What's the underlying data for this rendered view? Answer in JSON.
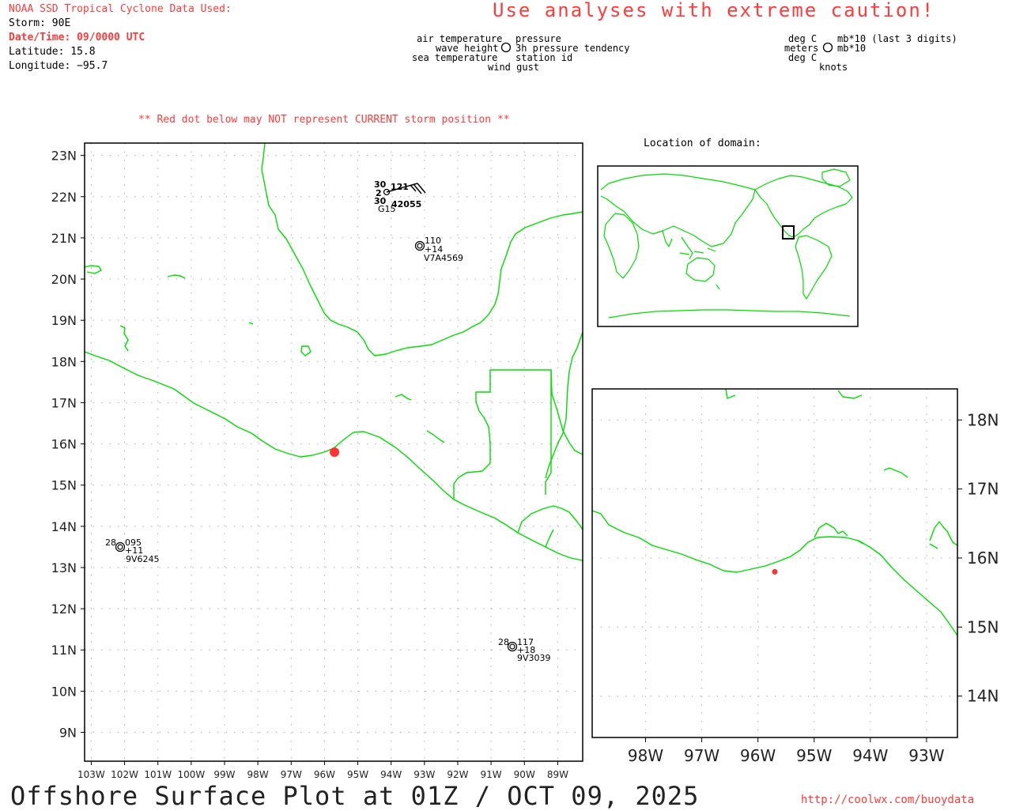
{
  "header": {
    "source": "NOAA SSD Tropical Cyclone Data Used:",
    "storm": "Storm: 90E",
    "datetime": "Date/Time: 09/0000 UTC",
    "latitude": "Latitude: 15.8",
    "longitude": "Longitude: −95.7",
    "caution": "Use analyses with extreme caution!"
  },
  "legend": {
    "left": {
      "air_temperature": "air temperature",
      "wave_height": "wave height",
      "sea_temperature": "sea temperature",
      "pressure": "pressure",
      "pressure_tendency": "3h pressure tendency",
      "station_id": "station id",
      "wind_gust": "wind gust"
    },
    "right": {
      "deg_c_top": "deg C",
      "meters": "meters",
      "deg_c_bottom": "deg C",
      "mb_last3": "mb*10 (last 3 digits)",
      "mb10": "mb*10",
      "knots": "knots"
    }
  },
  "warning": "** Red dot below may NOT represent CURRENT storm position **",
  "main_map": {
    "lat_labels": [
      "23N",
      "22N",
      "21N",
      "20N",
      "19N",
      "18N",
      "17N",
      "16N",
      "15N",
      "14N",
      "13N",
      "12N",
      "11N",
      "10N",
      "9N"
    ],
    "lon_labels": [
      "103W",
      "102W",
      "101W",
      "100W",
      "99W",
      "98W",
      "97W",
      "96W",
      "95W",
      "94W",
      "93W",
      "92W",
      "91W",
      "90W",
      "89W"
    ],
    "storm_position": {
      "lat": 15.8,
      "lon": -95.7,
      "color": "#ff3333"
    },
    "stations": [
      {
        "id": "42055",
        "air_temp": "30",
        "wave_height": "2",
        "sea_temp": "30",
        "pressure": "121",
        "gust": "G15",
        "lat": 22.0,
        "lon": -94.0
      },
      {
        "id": "V7A4569",
        "pressure": "110",
        "tendency": "+14",
        "lat": 20.8,
        "lon": -93.1
      },
      {
        "id": "9V6245",
        "air_temp": "28",
        "pressure": "095",
        "tendency": "+11",
        "lat": 13.5,
        "lon": -102.0
      },
      {
        "id": "9V3039",
        "air_temp": "28",
        "pressure": "117",
        "tendency": "+18",
        "lat": 11.1,
        "lon": -90.4
      }
    ]
  },
  "domain_inset": {
    "title": "Location of domain:"
  },
  "zoom_map": {
    "lat_labels": [
      "18N",
      "17N",
      "16N",
      "15N",
      "14N"
    ],
    "lon_labels": [
      "98W",
      "97W",
      "96W",
      "95W",
      "94W",
      "93W"
    ],
    "storm_position": {
      "lat": 15.8,
      "lon": -95.7
    }
  },
  "footer": {
    "title": "Offshore Surface Plot at 01Z / OCT 09, 2025",
    "url": "http://coolwx.com/buoydata"
  },
  "colors": {
    "coastline": "#00dd00",
    "alert_text": "#ff3b3b",
    "gust_text": "#0033ff",
    "grid": "#bbbbbb"
  }
}
